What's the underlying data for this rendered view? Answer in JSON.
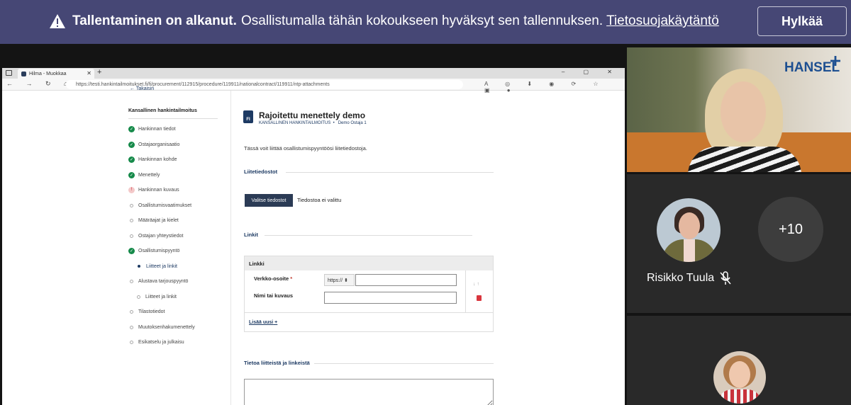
{
  "banner": {
    "title": "Tallentaminen on alkanut.",
    "message": "Osallistumalla tähän kokoukseen hyväksyt sen tallennuksen.",
    "privacy_link": "Tietosuojakäytäntö",
    "reject_label": "Hylkää",
    "bg_color": "#464775"
  },
  "browser": {
    "tab_title": "Hilma - Muokkaa",
    "url": "https://testi.hankintailmoitukset.fi/fi/procurement/112915/procedure/119911/nationalcontract/119911/ntp-attachments"
  },
  "app": {
    "back_label": "← Takaisin",
    "sidebar_title": "Kansallinen hankintailmoitus",
    "nav": [
      {
        "label": "Hankinnan tiedot",
        "status": "ok"
      },
      {
        "label": "Ostajaorganisaatio",
        "status": "ok"
      },
      {
        "label": "Hankinnan kohde",
        "status": "ok"
      },
      {
        "label": "Menettely",
        "status": "ok"
      },
      {
        "label": "Hankinnan kuvaus",
        "status": "warn"
      },
      {
        "label": "Osallistumisvaatimukset",
        "status": "empty"
      },
      {
        "label": "Määräajat ja kielet",
        "status": "empty"
      },
      {
        "label": "Ostajan yhteystiedot",
        "status": "empty"
      },
      {
        "label": "Osallistumispyyntö",
        "status": "ok"
      },
      {
        "label": "Liitteet ja linkit",
        "status": "active"
      },
      {
        "label": "Alustava tarjouspyyntö",
        "status": "empty"
      },
      {
        "label": "Liitteet ja linkit",
        "status": "empty"
      },
      {
        "label": "Tilastotiedot",
        "status": "empty"
      },
      {
        "label": "Muutoksenhakumenettely",
        "status": "empty"
      },
      {
        "label": "Esikatselu ja julkaisu",
        "status": "empty"
      }
    ],
    "doc_badge": "FI",
    "page_title": "Rajoitettu menettely demo",
    "breadcrumb_type": "KANSALLINEN HANKINTAILMOITUS",
    "breadcrumb_sep": "•",
    "breadcrumb_buyer": "Demo Ostaja 1",
    "intro_text": "Tässä voit liittää osallistumispyyntöösi liitetiedostoja.",
    "attachments_heading": "Liitetiedostot",
    "choose_files_label": "Valitse tiedostot",
    "no_file_text": "Tiedostoa ei valittu",
    "links_heading": "Linkit",
    "link_box_title": "Linkki",
    "url_label": "Verkko-osoite",
    "required_mark": "*",
    "protocol_value": "https://",
    "name_label": "Nimi tai kuvaus",
    "add_new_label": "Lisää uusi",
    "info_heading": "Tietoa liitteistä ja linkeistä"
  },
  "meeting": {
    "company_logo": "HANSEL",
    "participant_name": "Risikko Tuula",
    "overflow_count": "+10"
  }
}
